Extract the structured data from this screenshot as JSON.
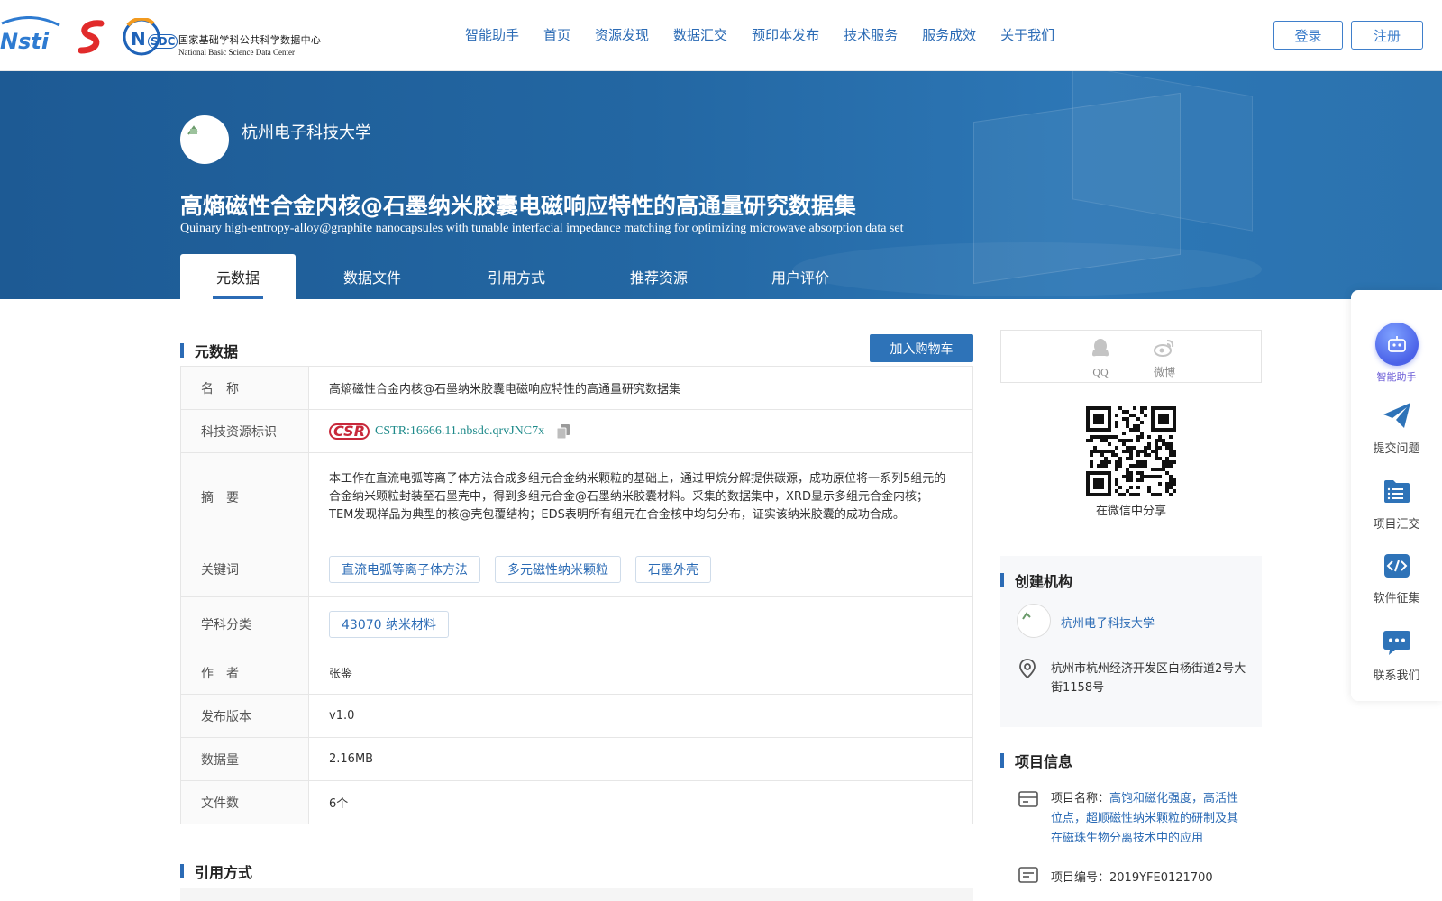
{
  "nav": {
    "logo_nsdc_cn": "国家基础学科公共科学数据中心",
    "logo_nsdc_en": "National Basic Science Data Center",
    "logo_nsdc_short": "SDC",
    "items": [
      "智能助手",
      "首页",
      "资源发现",
      "数据汇交",
      "预印本发布",
      "技术服务",
      "服务成效",
      "关于我们"
    ],
    "login": "登录",
    "register": "注册",
    "accent_color": "#2b6bb5"
  },
  "hero": {
    "institution": "杭州电子科技大学",
    "title": "高熵磁性合金内核@石墨纳米胶囊电磁响应特性的高通量研究数据集",
    "title_en": "Quinary high-entropy-alloy@graphite nanocapsules with tunable interfacial impedance matching for optimizing microwave absorption data set",
    "tabs": [
      "元数据",
      "数据文件",
      "引用方式",
      "推荐资源",
      "用户评价"
    ],
    "active_tab": "元数据"
  },
  "metadata": {
    "section_title": "元数据",
    "cart_button": "加入购物车",
    "rows": {
      "name": {
        "label": "名　称",
        "value": "高熵磁性合金内核@石墨纳米胶囊电磁响应特性的高通量研究数据集"
      },
      "cstr": {
        "label": "科技资源标识",
        "logo": "CSR",
        "value": "CSTR:16666.11.nbsdc.qrvJNC7x"
      },
      "abstract": {
        "label": "摘　要",
        "value": "本工作在直流电弧等离子体方法合成多组元合金纳米颗粒的基础上，通过甲烷分解提供碳源，成功原位将一系列5组元的合金纳米颗粒封装至石墨壳中，得到多组元合金@石墨纳米胶囊材料。采集的数据集中，XRD显示多组元合金内核；TEM发现样品为典型的核@壳包覆结构；EDS表明所有组元在合金核中均匀分布，证实该纳米胶囊的成功合成。"
      },
      "keywords": {
        "label": "关键词",
        "values": [
          "直流电弧等离子体方法",
          "多元磁性纳米颗粒",
          "石墨外壳"
        ]
      },
      "subject": {
        "label": "学科分类",
        "value": "43070 纳米材料"
      },
      "author": {
        "label": "作　者",
        "value": "张鉴"
      },
      "version": {
        "label": "发布版本",
        "value": "v1.0"
      },
      "size": {
        "label": "数据量",
        "value": "2.16MB"
      },
      "files": {
        "label": "文件数",
        "value": "6个"
      }
    }
  },
  "citation": {
    "section_title": "引用方式"
  },
  "share": {
    "qq": "QQ",
    "weibo": "微博",
    "wechat_caption": "在微信中分享"
  },
  "org": {
    "section_title": "创建机构",
    "name": "杭州电子科技大学",
    "address": "杭州市杭州经济开发区白杨街道2号大街1158号"
  },
  "project": {
    "section_title": "项目信息",
    "name_label": "项目名称：",
    "name_value": "高饱和磁化强度，高活性位点，超顺磁性纳米颗粒的研制及其在磁珠生物分离技术中的应用",
    "no_label": "项目编号：",
    "no_value": "2019YFE0121700"
  },
  "float_bar": {
    "items": [
      "智能助手",
      "提交问题",
      "项目汇交",
      "软件征集",
      "联系我们"
    ]
  }
}
